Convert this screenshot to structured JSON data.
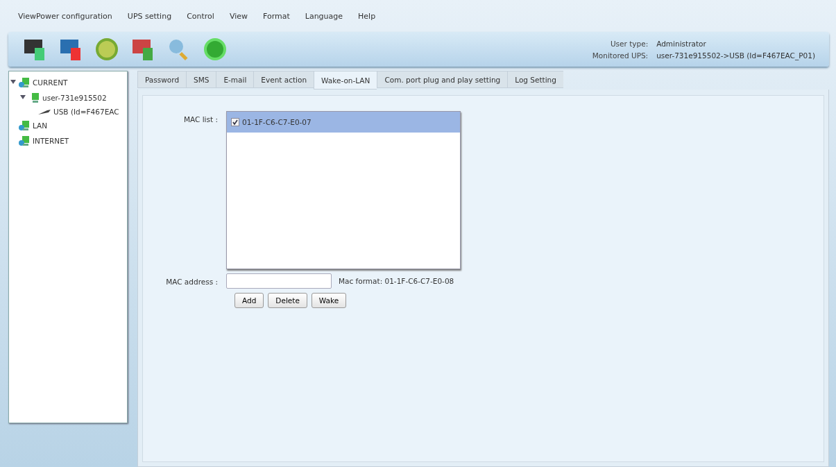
{
  "menu": [
    "ViewPower configuration",
    "UPS setting",
    "Control",
    "View",
    "Format",
    "Language",
    "Help"
  ],
  "info": [
    {
      "label": "User type:",
      "value": "Administrator"
    },
    {
      "label": "Monitored UPS:",
      "value": "user-731e915502->USB (Id=F467EAC_P01)"
    }
  ],
  "tree": [
    {
      "label": "CURRENT",
      "kind": "network",
      "expanded": true,
      "children": [
        {
          "label": "user-731e915502",
          "kind": "computer",
          "expanded": true,
          "children": [
            {
              "label": "USB (Id=F467EAC",
              "kind": "usb"
            }
          ]
        }
      ]
    },
    {
      "label": "LAN",
      "kind": "network"
    },
    {
      "label": "INTERNET",
      "kind": "network"
    }
  ],
  "tabs": [
    {
      "label": "Password",
      "selected": false
    },
    {
      "label": "SMS",
      "selected": false
    },
    {
      "label": "E-mail",
      "selected": false
    },
    {
      "label": "Event action",
      "selected": false
    },
    {
      "label": "Wake-on-LAN",
      "selected": true
    },
    {
      "label": "Com. port plug and play setting",
      "selected": false
    },
    {
      "label": "Log Setting",
      "selected": false
    }
  ],
  "mac_list": {
    "label": "MAC list :",
    "items": [
      {
        "address": "01-1F-C6-C7-E0-07",
        "checked": true,
        "selected": true
      }
    ]
  },
  "mac_address": {
    "label": "MAC address :",
    "hint": "Mac format: 01-1F-C6-C7-E0-08"
  },
  "buttons": [
    "Add",
    "Delete",
    "Wake"
  ]
}
